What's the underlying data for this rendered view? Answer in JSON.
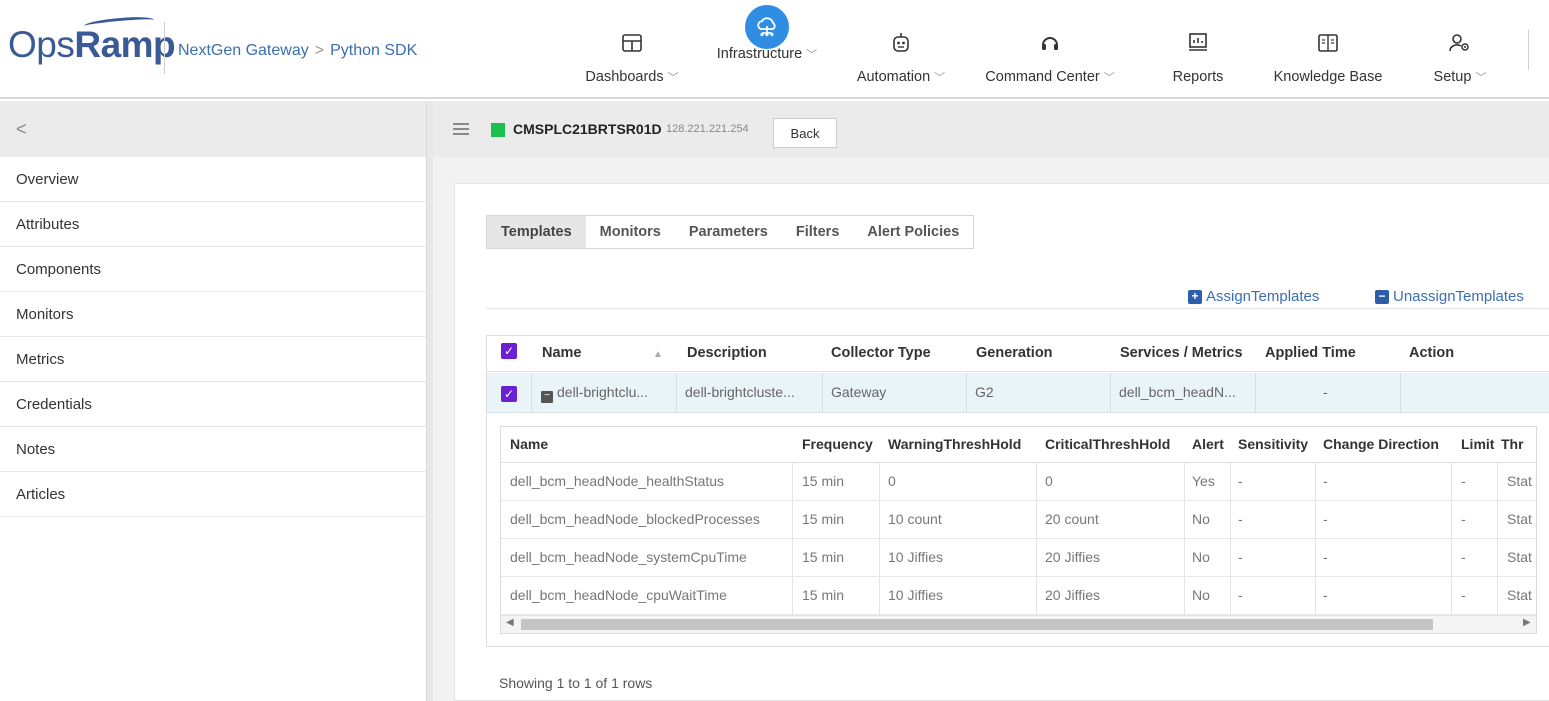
{
  "brand": {
    "logo_prefix": "Ops",
    "logo_bold": "Ramp"
  },
  "breadcrumb": {
    "parent": "NextGen Gateway",
    "separator": ">",
    "current": "Python SDK"
  },
  "nav": [
    {
      "label": "Dashboards",
      "icon": "dashboard-icon",
      "dropdown": true
    },
    {
      "label": "Infrastructure",
      "icon": "cloud-network-icon",
      "dropdown": true,
      "active": true
    },
    {
      "label": "Automation",
      "icon": "robot-icon",
      "dropdown": true
    },
    {
      "label": "Command Center",
      "icon": "headset-icon",
      "dropdown": true
    },
    {
      "label": "Reports",
      "icon": "report-icon",
      "dropdown": false
    },
    {
      "label": "Knowledge Base",
      "icon": "book-icon",
      "dropdown": false
    },
    {
      "label": "Setup",
      "icon": "user-gear-icon",
      "dropdown": true
    }
  ],
  "sidebar": {
    "collapse_glyph": "<",
    "items": [
      "Overview",
      "Attributes",
      "Components",
      "Monitors",
      "Metrics",
      "Credentials",
      "Notes",
      "Articles"
    ]
  },
  "resource": {
    "name": "CMSPLC21BRTSR01D",
    "ip": "128.221.221.254",
    "status_color": "#19c24c",
    "back_label": "Back"
  },
  "tabs": [
    "Templates",
    "Monitors",
    "Parameters",
    "Filters",
    "Alert Policies"
  ],
  "actions": {
    "assign": "AssignTemplates",
    "unassign": "UnassignTemplates"
  },
  "table": {
    "columns": [
      "Name",
      "Description",
      "Collector Type",
      "Generation",
      "Services / Metrics",
      "Applied Time",
      "Action"
    ],
    "rows": [
      {
        "checked": true,
        "name": "dell-brightclu...",
        "description": "dell-brightcluste...",
        "collector_type": "Gateway",
        "generation": "G2",
        "services_metrics": "dell_bcm_headN...",
        "applied_time": "-",
        "action": ""
      }
    ]
  },
  "subtable": {
    "columns": [
      "Name",
      "Frequency",
      "WarningThreshHold",
      "CriticalThreshHold",
      "Alert",
      "Sensitivity",
      "Change Direction",
      "Limit",
      "Thr"
    ],
    "rows": [
      [
        "dell_bcm_headNode_healthStatus",
        "15 min",
        "0",
        "0",
        "Yes",
        "-",
        "-",
        "-",
        "Stat"
      ],
      [
        "dell_bcm_headNode_blockedProcesses",
        "15 min",
        "10 count",
        "20 count",
        "No",
        "-",
        "-",
        "-",
        "Stat"
      ],
      [
        "dell_bcm_headNode_systemCpuTime",
        "15 min",
        "10 Jiffies",
        "20 Jiffies",
        "No",
        "-",
        "-",
        "-",
        "Stat"
      ],
      [
        "dell_bcm_headNode_cpuWaitTime",
        "15 min",
        "10 Jiffies",
        "20 Jiffies",
        "No",
        "-",
        "-",
        "-",
        "Stat"
      ]
    ]
  },
  "footer": {
    "showing": "Showing 1 to 1 of 1 rows"
  },
  "colors": {
    "accent": "#3b6fb0",
    "checkbox": "#6b1fd6",
    "selected_row": "#e8f4f8",
    "infra_active": "#2f8de4"
  }
}
